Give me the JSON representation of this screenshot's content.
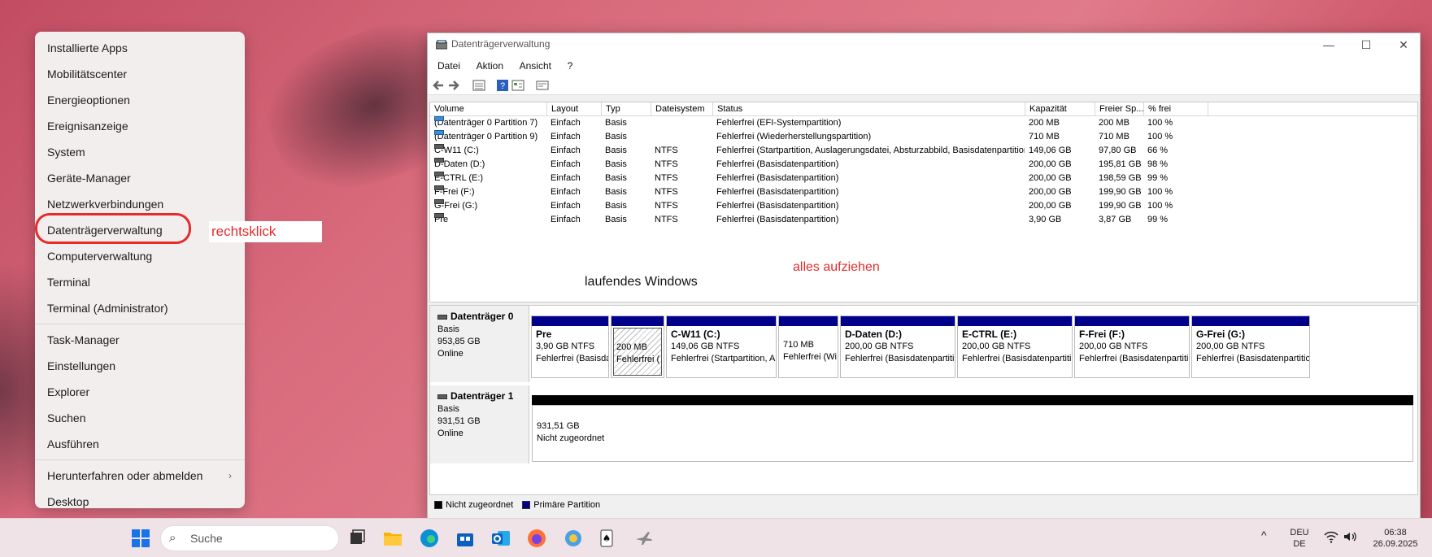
{
  "context_menu": {
    "items": [
      {
        "label": "Installierte Apps"
      },
      {
        "label": "Mobilitätscenter"
      },
      {
        "label": "Energieoptionen"
      },
      {
        "label": "Ereignisanzeige"
      },
      {
        "label": "System"
      },
      {
        "label": "Geräte-Manager"
      },
      {
        "label": "Netzwerkverbindungen"
      },
      {
        "label": "Datenträgerverwaltung"
      },
      {
        "label": "Computerverwaltung"
      },
      {
        "label": "Terminal"
      },
      {
        "label": "Terminal (Administrator)"
      },
      {
        "label": "Task-Manager"
      },
      {
        "label": "Einstellungen"
      },
      {
        "label": "Explorer"
      },
      {
        "label": "Suchen"
      },
      {
        "label": "Ausführen"
      },
      {
        "label": "Herunterfahren oder abmelden"
      },
      {
        "label": "Desktop"
      }
    ],
    "submenu_arrow": "›"
  },
  "annotations": {
    "rechtsklick": "rechtsklick",
    "laufendes_windows": "laufendes Windows",
    "alles_aufziehen": "alles aufziehen",
    "color": "#e52b2b"
  },
  "window": {
    "title": "Datenträgerverwaltung",
    "controls": {
      "minimize": "—",
      "maximize": "☐",
      "close": "✕"
    },
    "menu": [
      "Datei",
      "Aktion",
      "Ansicht",
      "?"
    ],
    "toolbar_icons": [
      "back-arrow-icon",
      "forward-arrow-icon",
      "list-view-icon",
      "help-icon",
      "properties-icon",
      "settings-icon"
    ]
  },
  "volume_table": {
    "columns": [
      "Volume",
      "Layout",
      "Typ",
      "Dateisystem",
      "Status",
      "Kapazität",
      "Freier Sp...",
      "% frei"
    ],
    "rows": [
      {
        "volume": "(Datenträger 0 Partition 7)",
        "layout": "Einfach",
        "typ": "Basis",
        "fs": "",
        "status": "Fehlerfrei (EFI-Systempartition)",
        "cap": "200 MB",
        "free": "200 MB",
        "pct": "100 %"
      },
      {
        "volume": "(Datenträger 0 Partition 9)",
        "layout": "Einfach",
        "typ": "Basis",
        "fs": "",
        "status": "Fehlerfrei (Wiederherstellungspartition)",
        "cap": "710 MB",
        "free": "710 MB",
        "pct": "100 %"
      },
      {
        "volume": "C-W11 (C:)",
        "layout": "Einfach",
        "typ": "Basis",
        "fs": "NTFS",
        "status": "Fehlerfrei (Startpartition, Auslagerungsdatei, Absturzabbild, Basisdatenpartition)",
        "cap": "149,06 GB",
        "free": "97,80 GB",
        "pct": "66 %"
      },
      {
        "volume": "D-Daten (D:)",
        "layout": "Einfach",
        "typ": "Basis",
        "fs": "NTFS",
        "status": "Fehlerfrei (Basisdatenpartition)",
        "cap": "200,00 GB",
        "free": "195,81 GB",
        "pct": "98 %"
      },
      {
        "volume": "E-CTRL (E:)",
        "layout": "Einfach",
        "typ": "Basis",
        "fs": "NTFS",
        "status": "Fehlerfrei (Basisdatenpartition)",
        "cap": "200,00 GB",
        "free": "198,59 GB",
        "pct": "99 %"
      },
      {
        "volume": "F-Frei (F:)",
        "layout": "Einfach",
        "typ": "Basis",
        "fs": "NTFS",
        "status": "Fehlerfrei (Basisdatenpartition)",
        "cap": "200,00 GB",
        "free": "199,90 GB",
        "pct": "100 %"
      },
      {
        "volume": "G-Frei (G:)",
        "layout": "Einfach",
        "typ": "Basis",
        "fs": "NTFS",
        "status": "Fehlerfrei (Basisdatenpartition)",
        "cap": "200,00 GB",
        "free": "199,90 GB",
        "pct": "100 %"
      },
      {
        "volume": "Pre",
        "layout": "Einfach",
        "typ": "Basis",
        "fs": "NTFS",
        "status": "Fehlerfrei (Basisdatenpartition)",
        "cap": "3,90 GB",
        "free": "3,87 GB",
        "pct": "99 %"
      }
    ]
  },
  "disks": [
    {
      "name": "Datenträger 0",
      "type": "Basis",
      "size": "953,85 GB",
      "state": "Online",
      "partitions": [
        {
          "name": "Pre",
          "size": "3,90 GB NTFS",
          "status": "Fehlerfrei (Basisda"
        },
        {
          "name": "",
          "size": "200 MB",
          "status": "Fehlerfrei (",
          "hatched": true
        },
        {
          "name": "C-W11  (C:)",
          "size": "149,06 GB NTFS",
          "status": "Fehlerfrei (Startpartition, Au"
        },
        {
          "name": "",
          "size": "710 MB",
          "status": "Fehlerfrei (Wi"
        },
        {
          "name": "D-Daten  (D:)",
          "size": "200,00 GB NTFS",
          "status": "Fehlerfrei (Basisdatenpartitic"
        },
        {
          "name": "E-CTRL  (E:)",
          "size": "200,00 GB NTFS",
          "status": "Fehlerfrei (Basisdatenpartitio"
        },
        {
          "name": "F-Frei  (F:)",
          "size": "200,00 GB NTFS",
          "status": "Fehlerfrei (Basisdatenpartitio"
        },
        {
          "name": "G-Frei  (G:)",
          "size": "200,00 GB NTFS",
          "status": "Fehlerfrei (Basisdatenpartitio"
        }
      ]
    },
    {
      "name": "Datenträger 1",
      "type": "Basis",
      "size": "931,51 GB",
      "state": "Online",
      "partitions": [
        {
          "name": "",
          "size": "931,51 GB",
          "status": "Nicht zugeordnet",
          "unallocated": true
        }
      ]
    }
  ],
  "legend": [
    {
      "label": "Nicht zugeordnet",
      "color": "#000000"
    },
    {
      "label": "Primäre Partition",
      "color": "#00008b"
    }
  ],
  "taskbar": {
    "search_placeholder": "Suche",
    "apps": [
      "start-icon",
      "task-view-icon",
      "file-explorer-icon",
      "edge-icon",
      "store-icon",
      "outlook-icon",
      "firefox-icon",
      "app-icon",
      "solitaire-icon",
      "airplane-app-icon"
    ],
    "language": "DEU",
    "region": "DE",
    "time": "06:38",
    "date": "26.09.2025",
    "chevron": "^"
  }
}
